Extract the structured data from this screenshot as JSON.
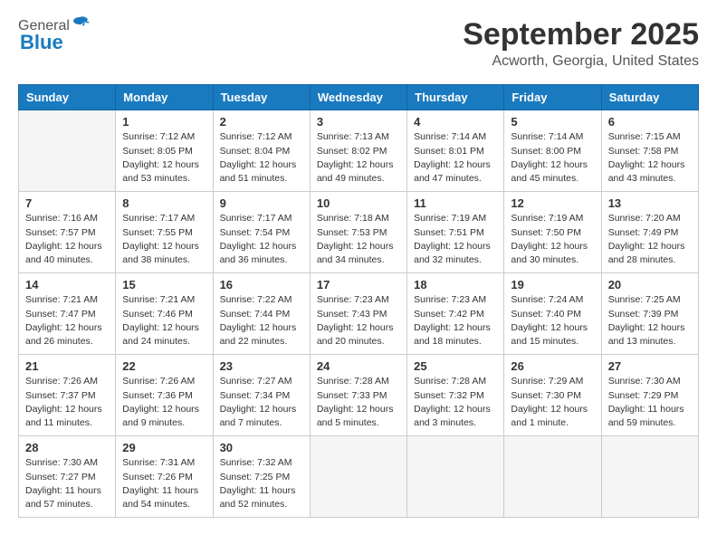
{
  "header": {
    "logo_general": "General",
    "logo_blue": "Blue",
    "month_title": "September 2025",
    "location": "Acworth, Georgia, United States"
  },
  "weekdays": [
    "Sunday",
    "Monday",
    "Tuesday",
    "Wednesday",
    "Thursday",
    "Friday",
    "Saturday"
  ],
  "weeks": [
    [
      {
        "day": "",
        "info": ""
      },
      {
        "day": "1",
        "info": "Sunrise: 7:12 AM\nSunset: 8:05 PM\nDaylight: 12 hours\nand 53 minutes."
      },
      {
        "day": "2",
        "info": "Sunrise: 7:12 AM\nSunset: 8:04 PM\nDaylight: 12 hours\nand 51 minutes."
      },
      {
        "day": "3",
        "info": "Sunrise: 7:13 AM\nSunset: 8:02 PM\nDaylight: 12 hours\nand 49 minutes."
      },
      {
        "day": "4",
        "info": "Sunrise: 7:14 AM\nSunset: 8:01 PM\nDaylight: 12 hours\nand 47 minutes."
      },
      {
        "day": "5",
        "info": "Sunrise: 7:14 AM\nSunset: 8:00 PM\nDaylight: 12 hours\nand 45 minutes."
      },
      {
        "day": "6",
        "info": "Sunrise: 7:15 AM\nSunset: 7:58 PM\nDaylight: 12 hours\nand 43 minutes."
      }
    ],
    [
      {
        "day": "7",
        "info": "Sunrise: 7:16 AM\nSunset: 7:57 PM\nDaylight: 12 hours\nand 40 minutes."
      },
      {
        "day": "8",
        "info": "Sunrise: 7:17 AM\nSunset: 7:55 PM\nDaylight: 12 hours\nand 38 minutes."
      },
      {
        "day": "9",
        "info": "Sunrise: 7:17 AM\nSunset: 7:54 PM\nDaylight: 12 hours\nand 36 minutes."
      },
      {
        "day": "10",
        "info": "Sunrise: 7:18 AM\nSunset: 7:53 PM\nDaylight: 12 hours\nand 34 minutes."
      },
      {
        "day": "11",
        "info": "Sunrise: 7:19 AM\nSunset: 7:51 PM\nDaylight: 12 hours\nand 32 minutes."
      },
      {
        "day": "12",
        "info": "Sunrise: 7:19 AM\nSunset: 7:50 PM\nDaylight: 12 hours\nand 30 minutes."
      },
      {
        "day": "13",
        "info": "Sunrise: 7:20 AM\nSunset: 7:49 PM\nDaylight: 12 hours\nand 28 minutes."
      }
    ],
    [
      {
        "day": "14",
        "info": "Sunrise: 7:21 AM\nSunset: 7:47 PM\nDaylight: 12 hours\nand 26 minutes."
      },
      {
        "day": "15",
        "info": "Sunrise: 7:21 AM\nSunset: 7:46 PM\nDaylight: 12 hours\nand 24 minutes."
      },
      {
        "day": "16",
        "info": "Sunrise: 7:22 AM\nSunset: 7:44 PM\nDaylight: 12 hours\nand 22 minutes."
      },
      {
        "day": "17",
        "info": "Sunrise: 7:23 AM\nSunset: 7:43 PM\nDaylight: 12 hours\nand 20 minutes."
      },
      {
        "day": "18",
        "info": "Sunrise: 7:23 AM\nSunset: 7:42 PM\nDaylight: 12 hours\nand 18 minutes."
      },
      {
        "day": "19",
        "info": "Sunrise: 7:24 AM\nSunset: 7:40 PM\nDaylight: 12 hours\nand 15 minutes."
      },
      {
        "day": "20",
        "info": "Sunrise: 7:25 AM\nSunset: 7:39 PM\nDaylight: 12 hours\nand 13 minutes."
      }
    ],
    [
      {
        "day": "21",
        "info": "Sunrise: 7:26 AM\nSunset: 7:37 PM\nDaylight: 12 hours\nand 11 minutes."
      },
      {
        "day": "22",
        "info": "Sunrise: 7:26 AM\nSunset: 7:36 PM\nDaylight: 12 hours\nand 9 minutes."
      },
      {
        "day": "23",
        "info": "Sunrise: 7:27 AM\nSunset: 7:34 PM\nDaylight: 12 hours\nand 7 minutes."
      },
      {
        "day": "24",
        "info": "Sunrise: 7:28 AM\nSunset: 7:33 PM\nDaylight: 12 hours\nand 5 minutes."
      },
      {
        "day": "25",
        "info": "Sunrise: 7:28 AM\nSunset: 7:32 PM\nDaylight: 12 hours\nand 3 minutes."
      },
      {
        "day": "26",
        "info": "Sunrise: 7:29 AM\nSunset: 7:30 PM\nDaylight: 12 hours\nand 1 minute."
      },
      {
        "day": "27",
        "info": "Sunrise: 7:30 AM\nSunset: 7:29 PM\nDaylight: 11 hours\nand 59 minutes."
      }
    ],
    [
      {
        "day": "28",
        "info": "Sunrise: 7:30 AM\nSunset: 7:27 PM\nDaylight: 11 hours\nand 57 minutes."
      },
      {
        "day": "29",
        "info": "Sunrise: 7:31 AM\nSunset: 7:26 PM\nDaylight: 11 hours\nand 54 minutes."
      },
      {
        "day": "30",
        "info": "Sunrise: 7:32 AM\nSunset: 7:25 PM\nDaylight: 11 hours\nand 52 minutes."
      },
      {
        "day": "",
        "info": ""
      },
      {
        "day": "",
        "info": ""
      },
      {
        "day": "",
        "info": ""
      },
      {
        "day": "",
        "info": ""
      }
    ]
  ]
}
